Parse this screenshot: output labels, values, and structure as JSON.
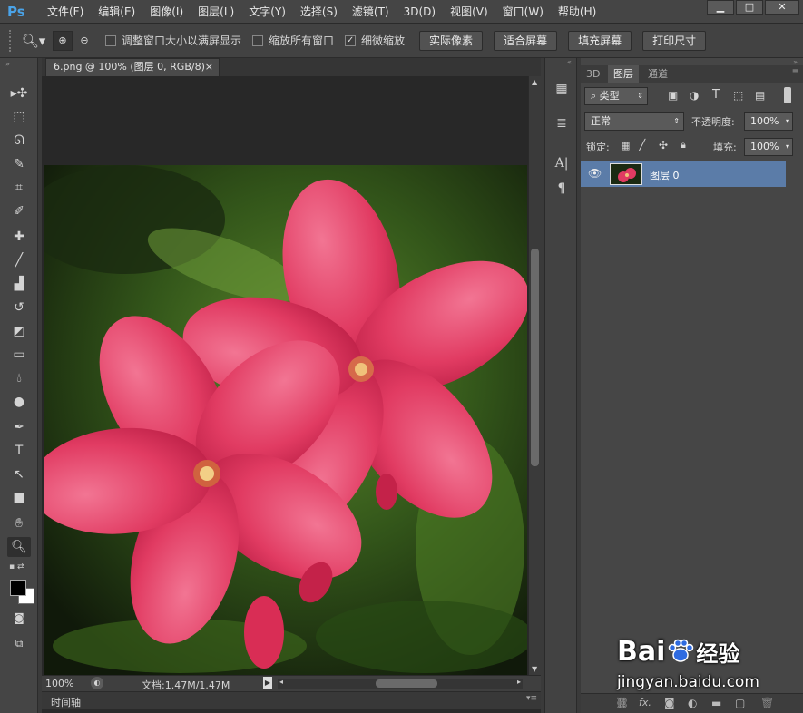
{
  "app": {
    "logo": "Ps"
  },
  "menu": [
    "文件(F)",
    "编辑(E)",
    "图像(I)",
    "图层(L)",
    "文字(Y)",
    "选择(S)",
    "滤镜(T)",
    "3D(D)",
    "视图(V)",
    "窗口(W)",
    "帮助(H)"
  ],
  "window_controls": [
    "▁",
    "□",
    "✕"
  ],
  "options": {
    "checkboxes": [
      {
        "label": "调整窗口大小以满屏显示",
        "checked": false
      },
      {
        "label": "缩放所有窗口",
        "checked": false
      },
      {
        "label": "细微缩放",
        "checked": true
      }
    ],
    "buttons": [
      "实际像素",
      "适合屏幕",
      "填充屏幕",
      "打印尺寸"
    ]
  },
  "document": {
    "tab_title": "6.png @ 100% (图层 0, RGB/8)",
    "tab_close": "×",
    "zoom": "100%",
    "doc_info": "文档:1.47M/1.47M",
    "timeline": "时间轴"
  },
  "panel": {
    "tabs": [
      "3D",
      "图层",
      "通道"
    ],
    "filter_label": "类型",
    "blend_mode": "正常",
    "opacity_label": "不透明度:",
    "opacity_value": "100%",
    "lock_label": "锁定:",
    "fill_label": "填充:",
    "fill_value": "100%",
    "layer_name": "图层 0"
  },
  "watermark": {
    "brand": "Bai",
    "brand_tail": "经验",
    "url": "jingyan.baidu.com"
  },
  "colors": {
    "accent": "#4aa3e8",
    "layer_selected": "#5b7ca8",
    "flower": "#e0395f"
  }
}
